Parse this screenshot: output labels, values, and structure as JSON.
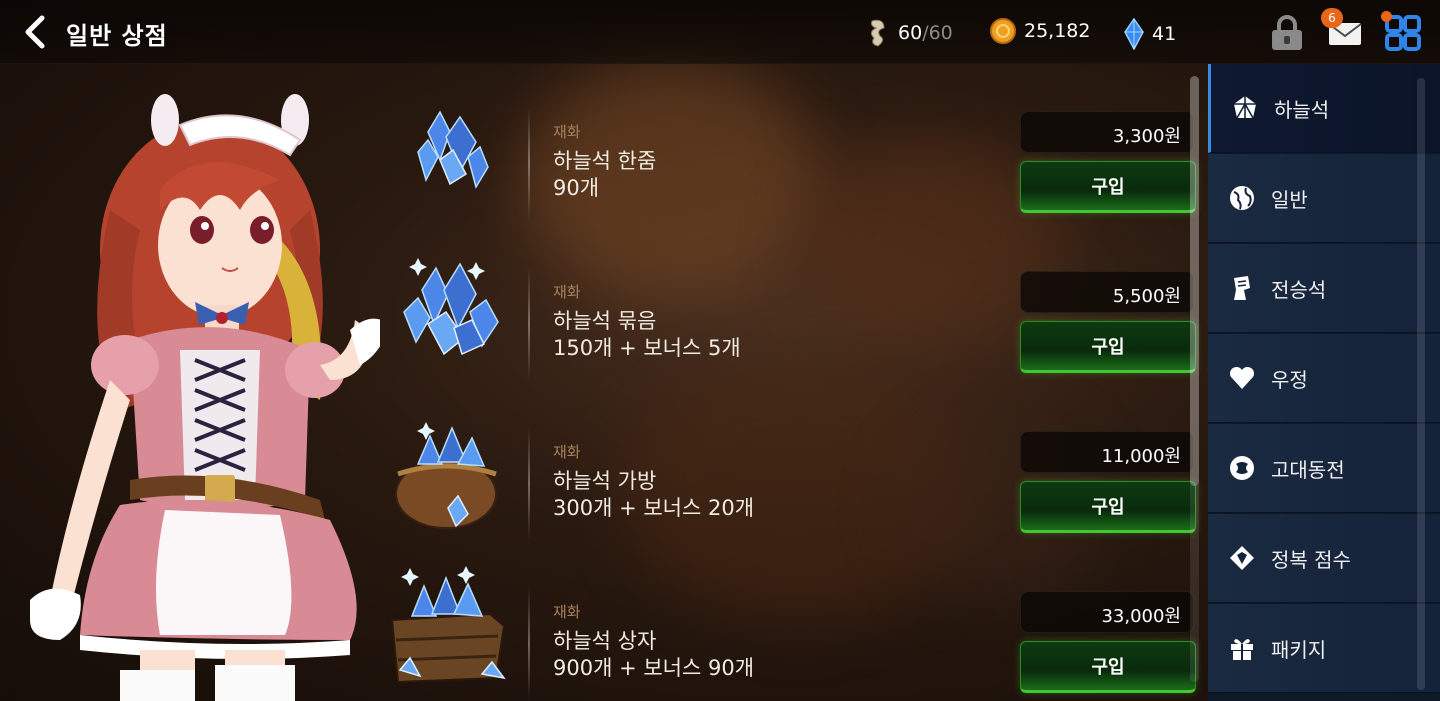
{
  "header": {
    "title": "일반 상점",
    "stamina": {
      "value": "60",
      "max": "/60"
    },
    "gold": "25,182",
    "gems": "41",
    "mail_badge": "6"
  },
  "products": [
    {
      "category": "재화",
      "name": "하늘석 한줌",
      "qty": "90개",
      "price": "3,300원",
      "buy_label": "구입",
      "icon": "crystal-handful-icon"
    },
    {
      "category": "재화",
      "name": "하늘석 묶음",
      "qty": "150개 + 보너스 5개",
      "price": "5,500원",
      "buy_label": "구입",
      "icon": "crystal-bundle-icon"
    },
    {
      "category": "재화",
      "name": "하늘석 가방",
      "qty": "300개 + 보너스 20개",
      "price": "11,000원",
      "buy_label": "구입",
      "icon": "crystal-bag-icon"
    },
    {
      "category": "재화",
      "name": "하늘석 상자",
      "qty": "900개 + 보너스 90개",
      "price": "33,000원",
      "buy_label": "구입",
      "icon": "crystal-chest-icon"
    }
  ],
  "sidenav": {
    "active_index": 0,
    "items": [
      {
        "label": "하늘석",
        "icon": "sky-stone-icon"
      },
      {
        "label": "일반",
        "icon": "globe-icon"
      },
      {
        "label": "전승석",
        "icon": "legacy-stone-icon"
      },
      {
        "label": "우정",
        "icon": "heart-icon"
      },
      {
        "label": "고대동전",
        "icon": "ancient-coin-icon"
      },
      {
        "label": "정복 점수",
        "icon": "conquest-icon"
      },
      {
        "label": "패키지",
        "icon": "gift-icon"
      }
    ]
  },
  "colors": {
    "accent_green": "#46c534",
    "category_text": "#a9815c",
    "nav_bg": "#14223a",
    "badge": "#e8651a"
  }
}
